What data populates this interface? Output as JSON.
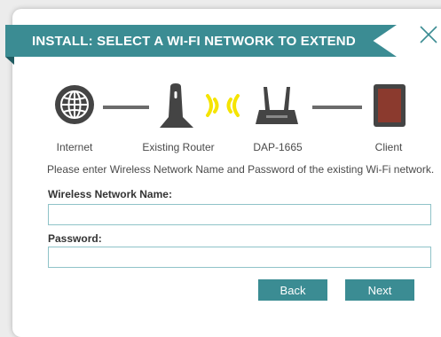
{
  "dialog": {
    "title": "INSTALL: SELECT A WI-FI NETWORK TO EXTEND",
    "close_icon": "close-icon",
    "accent_color": "#3b8c93"
  },
  "diagram": {
    "devices": [
      {
        "label": "Internet",
        "icon": "globe-icon"
      },
      {
        "label": "Existing Router",
        "icon": "router-icon"
      },
      {
        "label": "DAP-1665",
        "icon": "access-point-icon"
      },
      {
        "label": "Client",
        "icon": "tablet-icon"
      }
    ],
    "signal_icon": "wifi-signal-icon",
    "signal_color": "#f5e400"
  },
  "form": {
    "instruction": "Please enter Wireless Network Name and Password of the existing Wi-Fi network.",
    "network_name_label": "Wireless Network Name:",
    "network_name_value": "",
    "password_label": "Password:",
    "password_value": ""
  },
  "buttons": {
    "back": "Back",
    "next": "Next"
  }
}
